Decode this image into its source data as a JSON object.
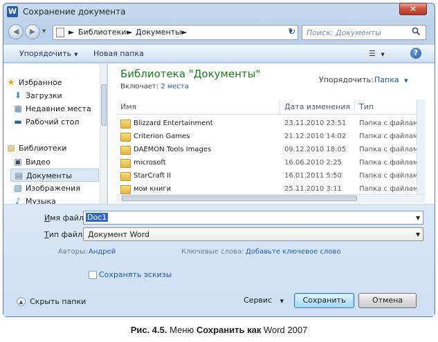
{
  "window": {
    "title": "Сохранение документа",
    "app_icon_letter": "W",
    "close_glyph": "✕"
  },
  "nav": {
    "back_glyph": "◀",
    "forward_glyph": "▶",
    "dropdown_glyph": "▼"
  },
  "address": {
    "segments": [
      "Библиотеки",
      "Документы"
    ],
    "separator": "►",
    "refresh_glyph": "↻"
  },
  "search": {
    "placeholder": "Поиск: Документы",
    "icon": "search-icon"
  },
  "toolbar": {
    "organize_label": "Упорядочить",
    "new_folder_label": "Новая папка",
    "help_glyph": "?",
    "views_glyph": "☰"
  },
  "sidebar": {
    "items": [
      {
        "label": "Избранное",
        "icon": "star-icon",
        "glyph": "★"
      },
      {
        "label": "Загрузки",
        "icon": "downloads-icon",
        "glyph": "⬇"
      },
      {
        "label": "Недавние места",
        "icon": "recent-places-icon",
        "glyph": "▦"
      },
      {
        "label": "Рабочий стол",
        "icon": "desktop-icon",
        "glyph": "▬"
      },
      {
        "label": "Библиотеки",
        "icon": "libraries-icon",
        "glyph": "▤"
      },
      {
        "label": "Видео",
        "icon": "video-icon",
        "glyph": "▣"
      },
      {
        "label": "Документы",
        "icon": "documents-icon",
        "glyph": "▤"
      },
      {
        "label": "Изображения",
        "icon": "images-icon",
        "glyph": "▧"
      },
      {
        "label": "Музыка",
        "icon": "music-icon",
        "glyph": "♪"
      }
    ]
  },
  "library": {
    "title": "Библиотека \"Документы\"",
    "includes_label": "Включает:",
    "includes_link": "2 места",
    "arrange_label": "Упорядочить:",
    "arrange_value": "Папка"
  },
  "columns": {
    "name": "Имя",
    "date": "Дата изменения",
    "type": "Тип"
  },
  "files": [
    {
      "name": "Blizzard Entertainment",
      "date": "23.11.2010 23:51",
      "type": "Папка с файлами"
    },
    {
      "name": "Criterion Games",
      "date": "21.12.2010 14:02",
      "type": "Папка с файлами"
    },
    {
      "name": "DAEMON Tools Images",
      "date": "09.12.2010 18:05",
      "type": "Папка с файлами"
    },
    {
      "name": "microsoft",
      "date": "16.06.2010 2:25",
      "type": "Папка с файлами"
    },
    {
      "name": "StarCraft II",
      "date": "16.01.2011 5:50",
      "type": "Папка с файлами"
    },
    {
      "name": "мои книги",
      "date": "25.11.2010 3:11",
      "type": "Папка с файлами"
    }
  ],
  "form": {
    "filename_label_u": "И",
    "filename_label_rest": "мя файла:",
    "filename_value": "Doc1",
    "filetype_label_u": "Т",
    "filetype_label_rest": "ип файла:",
    "filetype_value": "Документ Word",
    "authors_label": "Авторы:",
    "authors_value": "Андрей",
    "keywords_label": "Ключевые слова:",
    "keywords_value": "Добавьте ключевое слово",
    "thumbnails_label": "Сохранять эскизы"
  },
  "footer": {
    "hide_folders_label": "Скрыть папки",
    "service_label": "Сервис",
    "save_label": "Сохранить",
    "cancel_label": "Отмена"
  },
  "caption": {
    "prefix": "Рис. 4.5.",
    "text1": " Меню ",
    "bold": "Сохранить как",
    "text2": " Word 2007"
  }
}
